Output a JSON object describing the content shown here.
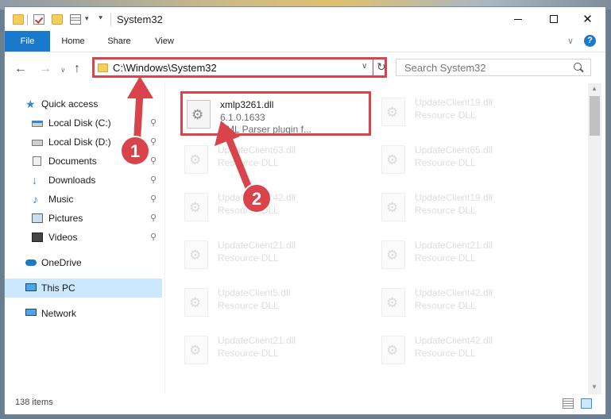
{
  "window": {
    "title": "System32",
    "minimize_glyph": "",
    "close_glyph": "✕"
  },
  "ribbon": {
    "tabs": [
      {
        "label": "File",
        "active": true
      },
      {
        "label": "Home"
      },
      {
        "label": "Share"
      },
      {
        "label": "View"
      }
    ],
    "expand_glyph": "∨",
    "help_glyph": "?"
  },
  "nav": {
    "back_glyph": "←",
    "forward_glyph": "→",
    "recent_glyph": "∨",
    "up_glyph": "↑",
    "address": "C:\\Windows\\System32",
    "address_dropdown_glyph": "∨",
    "refresh_glyph": "↻",
    "search_placeholder": "Search System32"
  },
  "sidebar": {
    "items": [
      {
        "label": "Quick access",
        "icon": "quick-access-icon",
        "pinned": false
      },
      {
        "label": "Local Disk (C:)",
        "icon": "local-disk-icon",
        "pinned": true
      },
      {
        "label": "Local Disk (D:)",
        "icon": "local-disk-icon",
        "pinned": true
      },
      {
        "label": "Documents",
        "icon": "documents-icon",
        "pinned": true
      },
      {
        "label": "Downloads",
        "icon": "downloads-icon",
        "pinned": true
      },
      {
        "label": "Music",
        "icon": "music-icon",
        "pinned": true
      },
      {
        "label": "Pictures",
        "icon": "pictures-icon",
        "pinned": true
      },
      {
        "label": "Videos",
        "icon": "videos-icon",
        "pinned": true
      },
      {
        "label": "OneDrive",
        "icon": "onedrive-icon",
        "pinned": false
      },
      {
        "label": "This PC",
        "icon": "this-pc-icon",
        "pinned": false,
        "selected": true
      },
      {
        "label": "Network",
        "icon": "network-icon",
        "pinned": false
      }
    ],
    "pin_glyph": "📌"
  },
  "files": [
    {
      "name": "xmlp3261.dll",
      "type": "6.1.0.1633",
      "desc": "XML Parser plugin f...",
      "highlighted": true
    },
    {
      "name": "UpdateClient19.dll",
      "type": "Resource DLL"
    },
    {
      "name": "UpdateClient63.dll",
      "type": "Resource DLL"
    },
    {
      "name": "UpdateClient65.dll",
      "type": "Resource DLL"
    },
    {
      "name": "UpdateClient42.dll",
      "type": "Resource DLL"
    },
    {
      "name": "UpdateClient19.dll",
      "type": "Resource DLL"
    },
    {
      "name": "UpdateClient21.dll",
      "type": "Resource DLL"
    },
    {
      "name": "UpdateClient21.dll",
      "type": "Resource DLL"
    },
    {
      "name": "UpdateClient5.dll",
      "type": "Resource DLL"
    },
    {
      "name": "UpdateClient42.dll",
      "type": "Resource DLL"
    },
    {
      "name": "UpdateClient21.dll",
      "type": "Resource DLL"
    },
    {
      "name": "UpdateClient42.dll",
      "type": "Resource DLL"
    }
  ],
  "status": {
    "item_count": "138 items"
  },
  "annotations": {
    "badge_1": "1",
    "badge_2": "2",
    "accent_color": "#d9434c"
  }
}
